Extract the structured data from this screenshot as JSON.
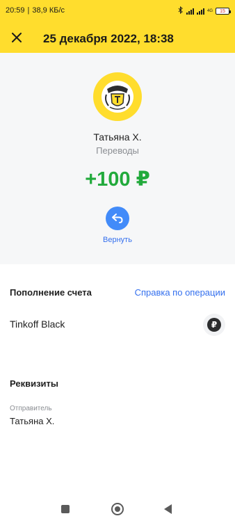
{
  "status_bar": {
    "time": "20:59",
    "speed": "38,9 КБ/с",
    "network": "4G",
    "battery": "15",
    "icons": [
      "bluetooth-icon",
      "signal-icon",
      "signal-icon",
      "battery-icon"
    ]
  },
  "header": {
    "title": "25 декабря 2022, 18:38",
    "close_icon": "close-icon"
  },
  "operation": {
    "counterparty": "Татьяна Х.",
    "category": "Переводы",
    "amount": "+100 ₽",
    "refund_label": "Вернуть",
    "logo_icon": "bank-logo-icon"
  },
  "details": {
    "section_title": "Пополнение счета",
    "help_link": "Справка по операции",
    "account_name": "Tinkoff Black",
    "currency_symbol": "₽"
  },
  "requisites": {
    "title": "Реквизиты",
    "sender_label": "Отправитель",
    "sender_value": "Татьяна Х."
  },
  "colors": {
    "brand_yellow": "#ffdd2d",
    "amount_green": "#22aa3c",
    "link_blue": "#336fee",
    "action_blue": "#428bf9"
  }
}
